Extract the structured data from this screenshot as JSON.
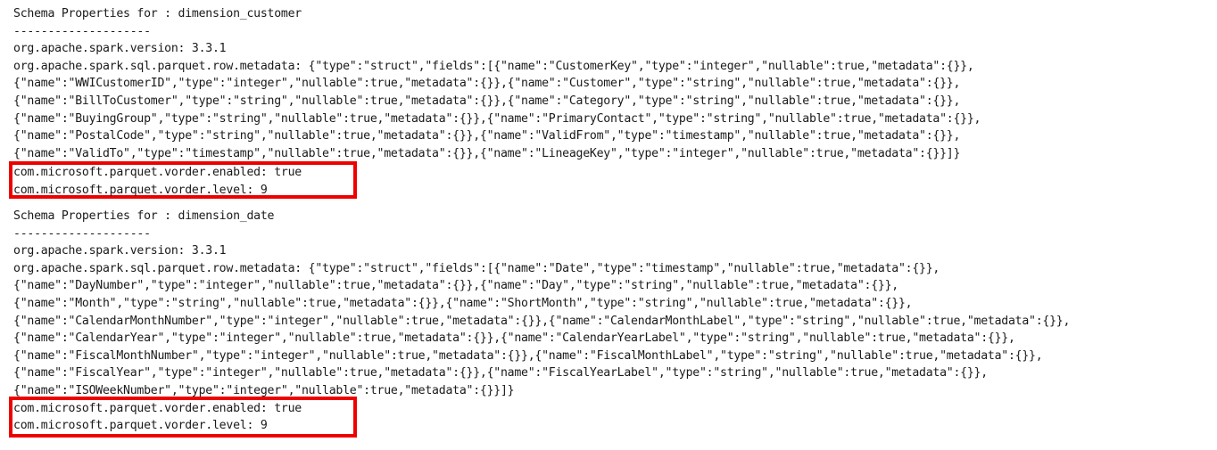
{
  "document": {
    "type": "console-output",
    "title": "Schema Properties Output",
    "text_color": "#1a1a1a",
    "background_color": "#ffffff",
    "highlight_color": "#ee0000"
  },
  "sections": [
    {
      "id": "dimension_customer",
      "header": "Schema Properties for : dimension_customer",
      "divider": "--------------------",
      "lines": [
        "org.apache.spark.version: 3.3.1",
        "org.apache.spark.sql.parquet.row.metadata: {\"type\":\"struct\",\"fields\":[{\"name\":\"CustomerKey\",\"type\":\"integer\",\"nullable\":true,\"metadata\":{}},",
        "{\"name\":\"WWICustomerID\",\"type\":\"integer\",\"nullable\":true,\"metadata\":{}},{\"name\":\"Customer\",\"type\":\"string\",\"nullable\":true,\"metadata\":{}},",
        "{\"name\":\"BillToCustomer\",\"type\":\"string\",\"nullable\":true,\"metadata\":{}},{\"name\":\"Category\",\"type\":\"string\",\"nullable\":true,\"metadata\":{}},",
        "{\"name\":\"BuyingGroup\",\"type\":\"string\",\"nullable\":true,\"metadata\":{}},{\"name\":\"PrimaryContact\",\"type\":\"string\",\"nullable\":true,\"metadata\":{}},",
        "{\"name\":\"PostalCode\",\"type\":\"string\",\"nullable\":true,\"metadata\":{}},{\"name\":\"ValidFrom\",\"type\":\"timestamp\",\"nullable\":true,\"metadata\":{}},",
        "{\"name\":\"ValidTo\",\"type\":\"timestamp\",\"nullable\":true,\"metadata\":{}},{\"name\":\"LineageKey\",\"type\":\"integer\",\"nullable\":true,\"metadata\":{}}]}"
      ],
      "highlighted": [
        "com.microsoft.parquet.vorder.enabled: true",
        "com.microsoft.parquet.vorder.level: 9"
      ]
    },
    {
      "id": "dimension_date",
      "header": "Schema Properties for : dimension_date",
      "divider": "--------------------",
      "lines": [
        "org.apache.spark.version: 3.3.1",
        "org.apache.spark.sql.parquet.row.metadata: {\"type\":\"struct\",\"fields\":[{\"name\":\"Date\",\"type\":\"timestamp\",\"nullable\":true,\"metadata\":{}},",
        "{\"name\":\"DayNumber\",\"type\":\"integer\",\"nullable\":true,\"metadata\":{}},{\"name\":\"Day\",\"type\":\"string\",\"nullable\":true,\"metadata\":{}},",
        "{\"name\":\"Month\",\"type\":\"string\",\"nullable\":true,\"metadata\":{}},{\"name\":\"ShortMonth\",\"type\":\"string\",\"nullable\":true,\"metadata\":{}},",
        "{\"name\":\"CalendarMonthNumber\",\"type\":\"integer\",\"nullable\":true,\"metadata\":{}},{\"name\":\"CalendarMonthLabel\",\"type\":\"string\",\"nullable\":true,\"metadata\":{}},",
        "{\"name\":\"CalendarYear\",\"type\":\"integer\",\"nullable\":true,\"metadata\":{}},{\"name\":\"CalendarYearLabel\",\"type\":\"string\",\"nullable\":true,\"metadata\":{}},",
        "{\"name\":\"FiscalMonthNumber\",\"type\":\"integer\",\"nullable\":true,\"metadata\":{}},{\"name\":\"FiscalMonthLabel\",\"type\":\"string\",\"nullable\":true,\"metadata\":{}},",
        "{\"name\":\"FiscalYear\",\"type\":\"integer\",\"nullable\":true,\"metadata\":{}},{\"name\":\"FiscalYearLabel\",\"type\":\"string\",\"nullable\":true,\"metadata\":{}},",
        "{\"name\":\"ISOWeekNumber\",\"type\":\"integer\",\"nullable\":true,\"metadata\":{}}]}"
      ],
      "highlighted": [
        "com.microsoft.parquet.vorder.enabled: true",
        "com.microsoft.parquet.vorder.level: 9"
      ]
    }
  ]
}
